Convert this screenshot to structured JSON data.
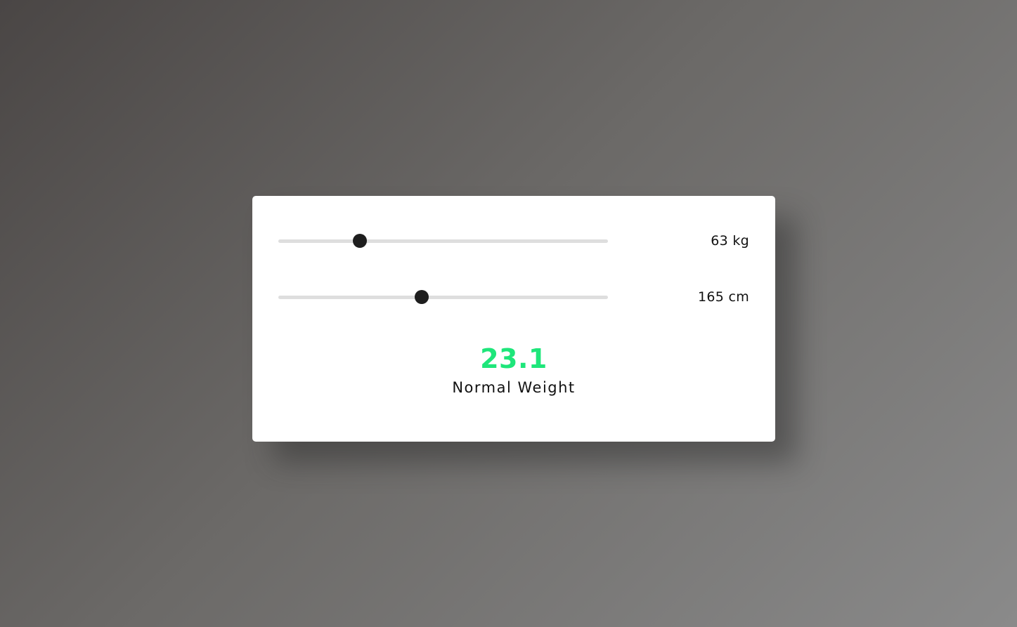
{
  "calculator": {
    "weight": {
      "value": 63,
      "display": "63 kg",
      "slider_fraction": 0.248
    },
    "height": {
      "value": 165,
      "display": "165 cm",
      "slider_fraction": 0.435
    },
    "result": {
      "bmi": "23.1",
      "category": "Normal Weight"
    }
  },
  "colors": {
    "bmi_value": "#1ee67a",
    "card_background": "#ffffff",
    "slider_track": "#dedede",
    "slider_thumb": "#1e1e1e"
  }
}
